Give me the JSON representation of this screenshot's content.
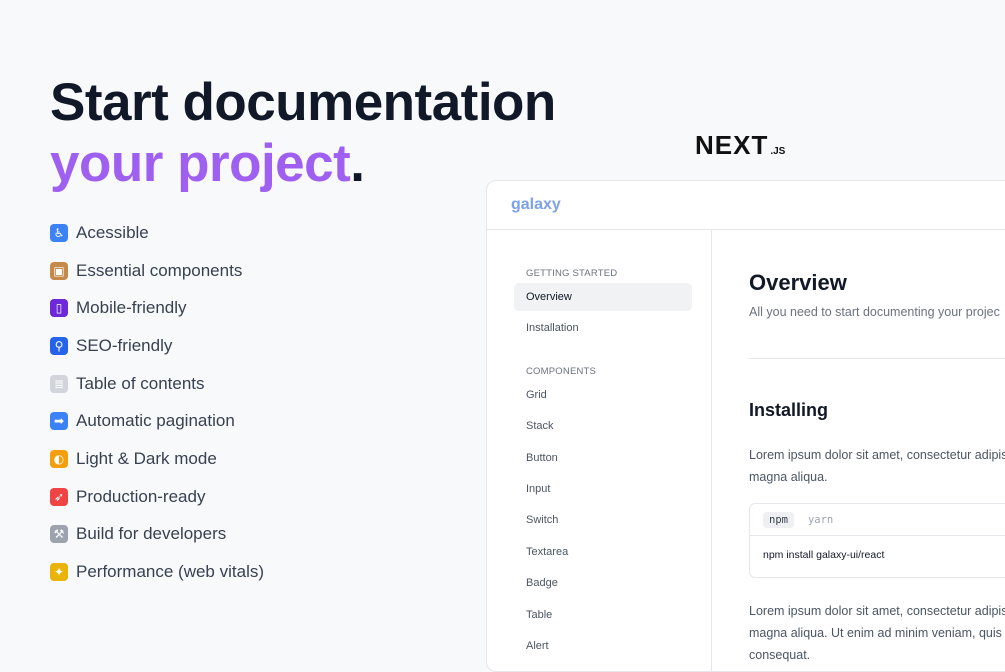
{
  "hero": {
    "line1": "Start documentation",
    "line2_accent": "your project",
    "line2_dot": ".",
    "accent_color": "#9f5ff0"
  },
  "features": [
    {
      "icon": "wheelchair-icon",
      "glyph": "♿",
      "color": "#3b82f6",
      "label": "Acessible"
    },
    {
      "icon": "package-icon",
      "glyph": "▣",
      "color": "#c58a4a",
      "label": "Essential components"
    },
    {
      "icon": "mobile-phone-icon",
      "glyph": "▯",
      "color": "#6d28d9",
      "label": "Mobile-friendly"
    },
    {
      "icon": "magnifier-icon",
      "glyph": "⚲",
      "color": "#2563eb",
      "label": "SEO-friendly"
    },
    {
      "icon": "bookmark-tabs-icon",
      "glyph": "≣",
      "color": "#d1d5db",
      "label": "Table of contents"
    },
    {
      "icon": "right-arrow-icon",
      "glyph": "➡",
      "color": "#3b82f6",
      "label": "Automatic pagination"
    },
    {
      "icon": "half-moon-icon",
      "glyph": "◐",
      "color": "#f59e0b",
      "label": "Light & Dark mode"
    },
    {
      "icon": "rocket-icon",
      "glyph": "➶",
      "color": "#ef4444",
      "label": "Production-ready"
    },
    {
      "icon": "hammer-wrench-icon",
      "glyph": "⚒",
      "color": "#9ca3af",
      "label": "Build for developers"
    },
    {
      "icon": "party-popper-icon",
      "glyph": "✦",
      "color": "#eab308",
      "label": "Performance (web vitals)"
    }
  ],
  "next_logo": {
    "word": "NEXT",
    "suffix": ".JS"
  },
  "preview": {
    "brand": "galaxy",
    "sidebar": {
      "group1": "GETTING STARTED",
      "group1_items": [
        "Overview",
        "Installation"
      ],
      "group2": "COMPONENTS",
      "group2_items": [
        "Grid",
        "Stack",
        "Button",
        "Input",
        "Switch",
        "Textarea",
        "Badge",
        "Table",
        "Alert"
      ]
    },
    "content": {
      "title": "Overview",
      "lead": "All you need to start documenting your projec",
      "section_title": "Installing",
      "para1_line1": "Lorem ipsum dolor sit amet, consectetur adipis",
      "para1_line2": "magna aliqua.",
      "code_tabs": [
        "npm",
        "yarn"
      ],
      "code_line": "npm install galaxy-ui/react",
      "para2_line1": "Lorem ipsum dolor sit amet, consectetur adipis",
      "para2_line2": "magna aliqua. Ut enim ad minim veniam, quis",
      "para2_line3": "consequat."
    }
  }
}
